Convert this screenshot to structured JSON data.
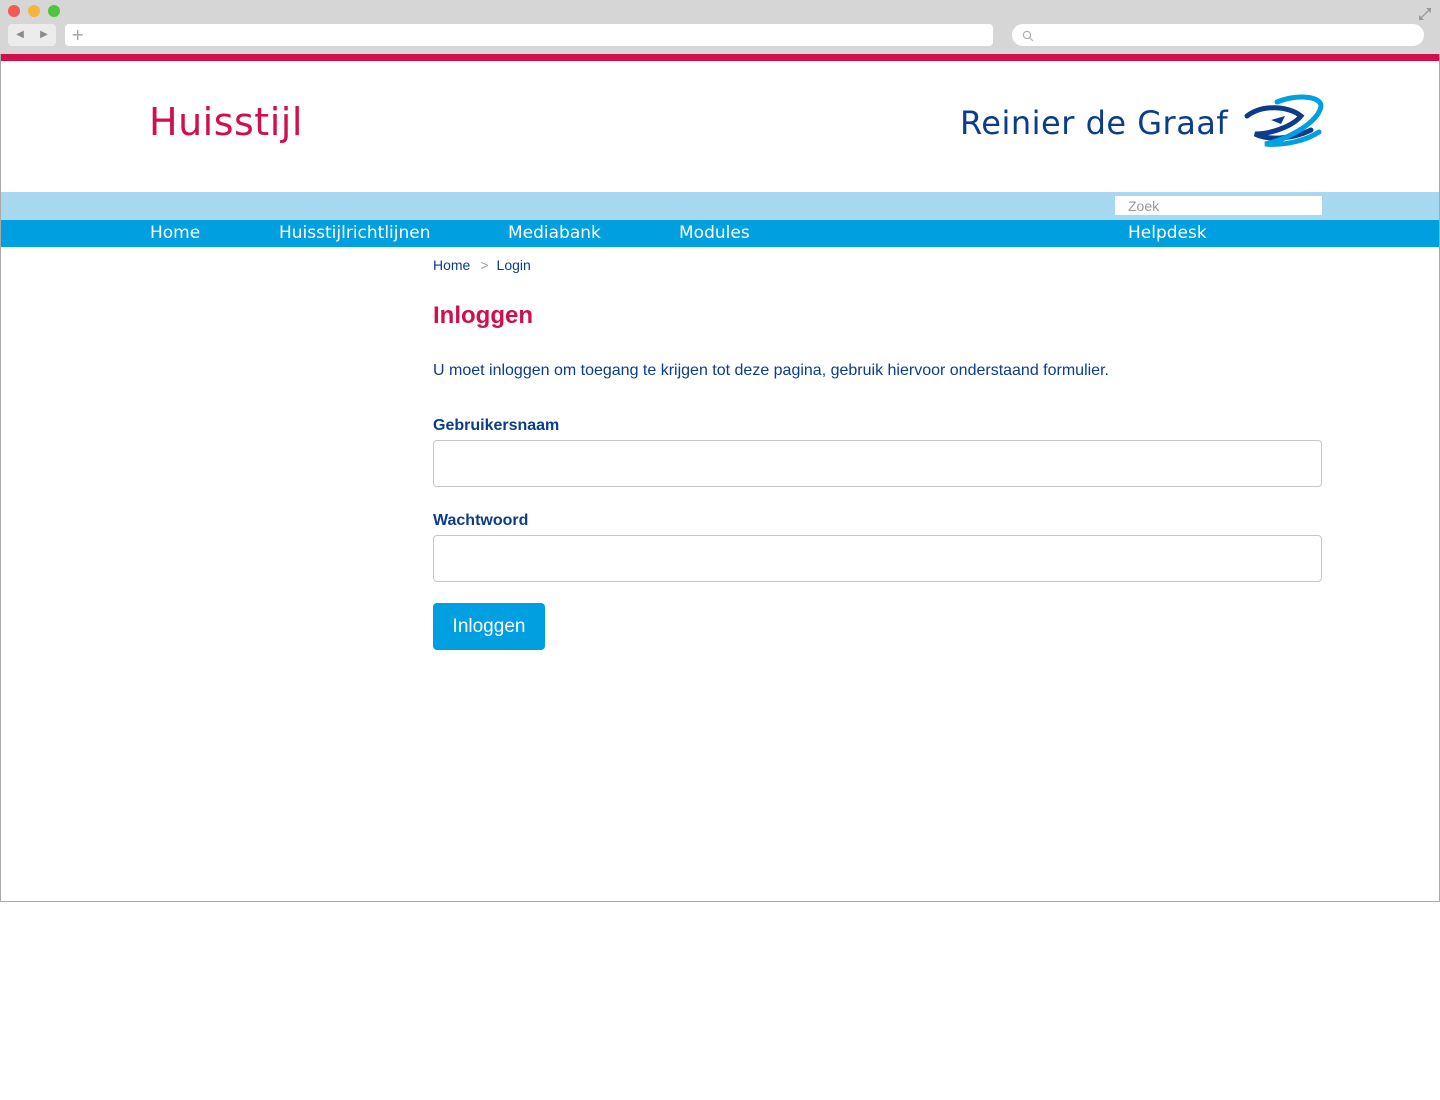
{
  "browser": {
    "back_icon": "◀",
    "forward_icon": "▶",
    "new_tab_icon": "+",
    "url": "",
    "search_value": ""
  },
  "header": {
    "site_logo": "Huisstijl",
    "org_logo": "Reinier de Graaf"
  },
  "search": {
    "placeholder": "Zoek"
  },
  "nav": {
    "items": [
      "Home",
      "Huisstijlrichtlijnen",
      "Mediabank",
      "Modules",
      "Helpdesk"
    ]
  },
  "breadcrumb": {
    "home": "Home",
    "separator": ">",
    "current": "Login"
  },
  "login": {
    "title": "Inloggen",
    "intro": "U moet inloggen om toegang te krijgen tot deze pagina, gebruik hiervoor onderstaand formulier.",
    "username_label": "Gebruikersnaam",
    "username_value": "",
    "password_label": "Wachtwoord",
    "password_value": "",
    "submit_label": "Inloggen"
  },
  "colors": {
    "brand_pink": "#d0104c",
    "brand_blue": "#009fe0",
    "light_blue": "#a8d8ef",
    "text_navy": "#0c3c8c"
  }
}
